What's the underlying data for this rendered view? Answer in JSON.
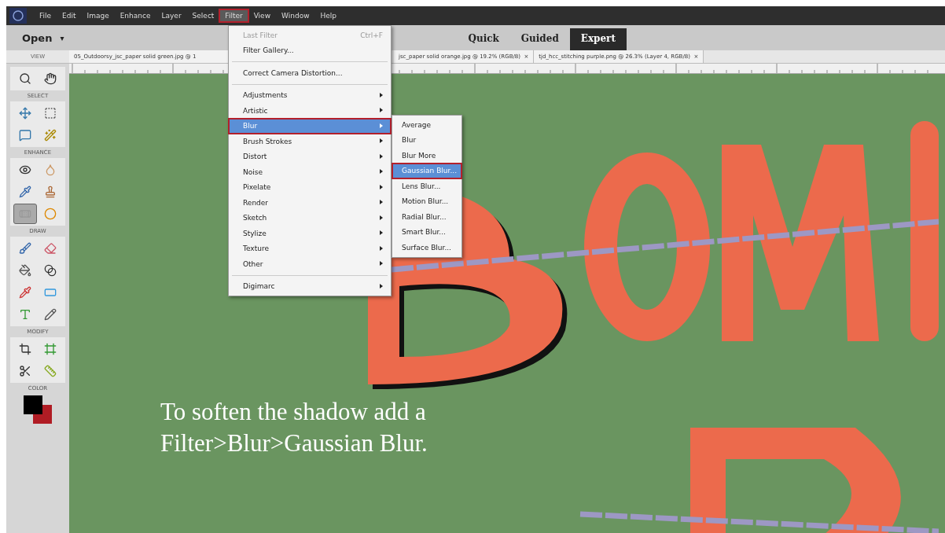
{
  "menubar": {
    "items": [
      {
        "label": "File",
        "selected": false,
        "annotated": false
      },
      {
        "label": "Edit",
        "selected": false,
        "annotated": false
      },
      {
        "label": "Image",
        "selected": false,
        "annotated": false
      },
      {
        "label": "Enhance",
        "selected": false,
        "annotated": false
      },
      {
        "label": "Layer",
        "selected": false,
        "annotated": false
      },
      {
        "label": "Select",
        "selected": false,
        "annotated": false
      },
      {
        "label": "Filter",
        "selected": true,
        "annotated": true
      },
      {
        "label": "View",
        "selected": false,
        "annotated": false
      },
      {
        "label": "Window",
        "selected": false,
        "annotated": false
      },
      {
        "label": "Help",
        "selected": false,
        "annotated": false
      }
    ]
  },
  "header": {
    "open_label": "Open",
    "caret": "▾",
    "modes": [
      {
        "label": "Quick",
        "selected": false
      },
      {
        "label": "Guided",
        "selected": false
      },
      {
        "label": "Expert",
        "selected": true
      }
    ]
  },
  "doc_tabs": [
    {
      "label": "05_Outdoorsy_jsc_paper solid green.jpg @ 1"
    },
    {
      "label": "jsc_paper solid orange.jpg @ 19.2% (RGB/8)",
      "close": "×"
    },
    {
      "label": "tjd_hcc_stitching purple.png @ 26.3% (Layer 4, RGB/8)",
      "close": "×"
    }
  ],
  "toolbox": {
    "sections": [
      {
        "title": "VIEW",
        "tools": [
          {
            "selected": false
          },
          {
            "selected": false
          }
        ]
      },
      {
        "title": "SELECT",
        "tools": [
          {
            "selected": false
          },
          {
            "selected": false
          },
          {
            "selected": false
          },
          {
            "selected": false
          }
        ]
      },
      {
        "title": "ENHANCE",
        "tools": [
          {
            "selected": false
          },
          {
            "selected": false
          },
          {
            "selected": false
          },
          {
            "selected": false
          },
          {
            "selected": true
          },
          {
            "selected": false
          }
        ]
      },
      {
        "title": "DRAW",
        "tools": [
          {
            "selected": false
          },
          {
            "selected": false
          },
          {
            "selected": false
          },
          {
            "selected": false
          },
          {
            "selected": false
          },
          {
            "selected": false
          },
          {
            "selected": false
          },
          {
            "selected": false
          }
        ]
      },
      {
        "title": "MODIFY",
        "tools": [
          {
            "selected": false
          },
          {
            "selected": false
          },
          {
            "selected": false
          },
          {
            "selected": false
          }
        ]
      }
    ],
    "color_title": "COLOR"
  },
  "canvas": {
    "caption_lines": [
      "To soften the shadow add a",
      "Filter>Blur>Gaussian Blur."
    ]
  },
  "filter_menu": {
    "items": [
      {
        "kind": "item",
        "label": "Last Filter",
        "shortcut": "Ctrl+F",
        "disabled": true
      },
      {
        "kind": "item",
        "label": "Filter Gallery...",
        "disabled": false
      },
      {
        "kind": "separator"
      },
      {
        "kind": "item",
        "label": "Correct Camera Distortion...",
        "disabled": false
      },
      {
        "kind": "separator"
      },
      {
        "kind": "submenu",
        "label": "Adjustments",
        "selected": false,
        "annotated": false
      },
      {
        "kind": "submenu",
        "label": "Artistic",
        "selected": false,
        "annotated": false
      },
      {
        "kind": "submenu",
        "label": "Blur",
        "selected": true,
        "annotated": true
      },
      {
        "kind": "submenu",
        "label": "Brush Strokes",
        "selected": false,
        "annotated": false
      },
      {
        "kind": "submenu",
        "label": "Distort",
        "selected": false,
        "annotated": false
      },
      {
        "kind": "submenu",
        "label": "Noise",
        "selected": false,
        "annotated": false
      },
      {
        "kind": "submenu",
        "label": "Pixelate",
        "selected": false,
        "annotated": false
      },
      {
        "kind": "submenu",
        "label": "Render",
        "selected": false,
        "annotated": false
      },
      {
        "kind": "submenu",
        "label": "Sketch",
        "selected": false,
        "annotated": false
      },
      {
        "kind": "submenu",
        "label": "Stylize",
        "selected": false,
        "annotated": false
      },
      {
        "kind": "submenu",
        "label": "Texture",
        "selected": false,
        "annotated": false
      },
      {
        "kind": "submenu",
        "label": "Other",
        "selected": false,
        "annotated": false
      },
      {
        "kind": "separator"
      },
      {
        "kind": "submenu",
        "label": "Digimarc",
        "selected": false,
        "annotated": false
      }
    ]
  },
  "blur_submenu": {
    "items": [
      {
        "label": "Average",
        "selected": false,
        "annotated": false
      },
      {
        "label": "Blur",
        "selected": false,
        "annotated": false
      },
      {
        "label": "Blur More",
        "selected": false,
        "annotated": false
      },
      {
        "label": "Gaussian Blur...",
        "selected": true,
        "annotated": true
      },
      {
        "label": "Lens Blur...",
        "selected": false,
        "annotated": false
      },
      {
        "label": "Motion Blur...",
        "selected": false,
        "annotated": false
      },
      {
        "label": "Radial Blur...",
        "selected": false,
        "annotated": false
      },
      {
        "label": "Smart Blur...",
        "selected": false,
        "annotated": false
      },
      {
        "label": "Surface Blur...",
        "selected": false,
        "annotated": false
      }
    ]
  }
}
